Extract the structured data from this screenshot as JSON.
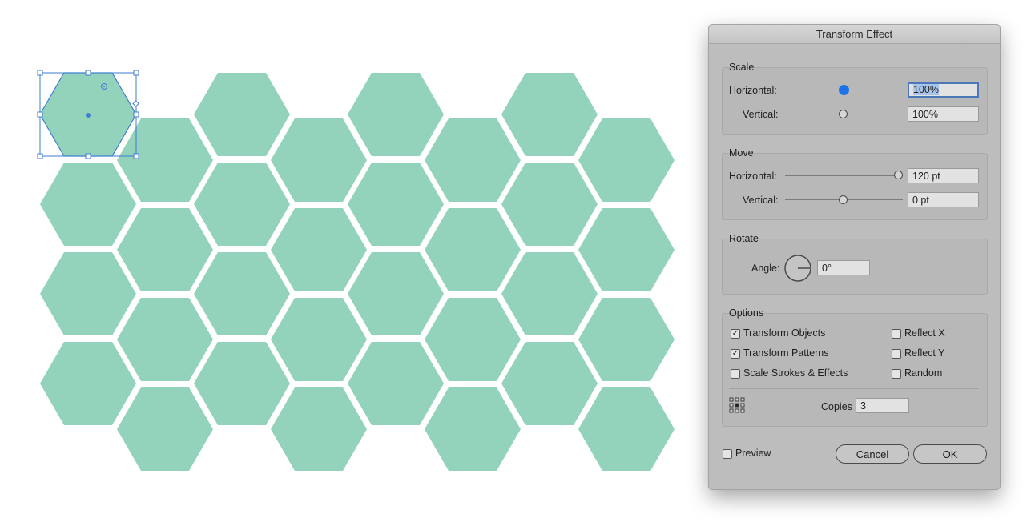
{
  "canvas": {
    "hex_fill": "#93d3bb",
    "selection_color": "#3f7ecf"
  },
  "dialog": {
    "title": "Transform Effect",
    "scale": {
      "label": "Scale",
      "horizontal_label": "Horizontal:",
      "horizontal_value": "100%",
      "vertical_label": "Vertical:",
      "vertical_value": "100%"
    },
    "move": {
      "label": "Move",
      "horizontal_label": "Horizontal:",
      "horizontal_value": "120 pt",
      "vertical_label": "Vertical:",
      "vertical_value": "0 pt"
    },
    "rotate": {
      "label": "Rotate",
      "angle_label": "Angle:",
      "angle_value": "0°"
    },
    "options": {
      "label": "Options",
      "transform_objects": "Transform Objects",
      "transform_patterns": "Transform Patterns",
      "scale_strokes": "Scale Strokes & Effects",
      "reflect_x": "Reflect X",
      "reflect_y": "Reflect Y",
      "random": "Random",
      "copies_label": "Copies",
      "copies_value": "3",
      "checked": {
        "transform_objects": true,
        "transform_patterns": true,
        "scale_strokes": false,
        "reflect_x": false,
        "reflect_y": false,
        "random": false,
        "preview": false
      }
    },
    "preview_label": "Preview",
    "cancel_label": "Cancel",
    "ok_label": "OK"
  }
}
